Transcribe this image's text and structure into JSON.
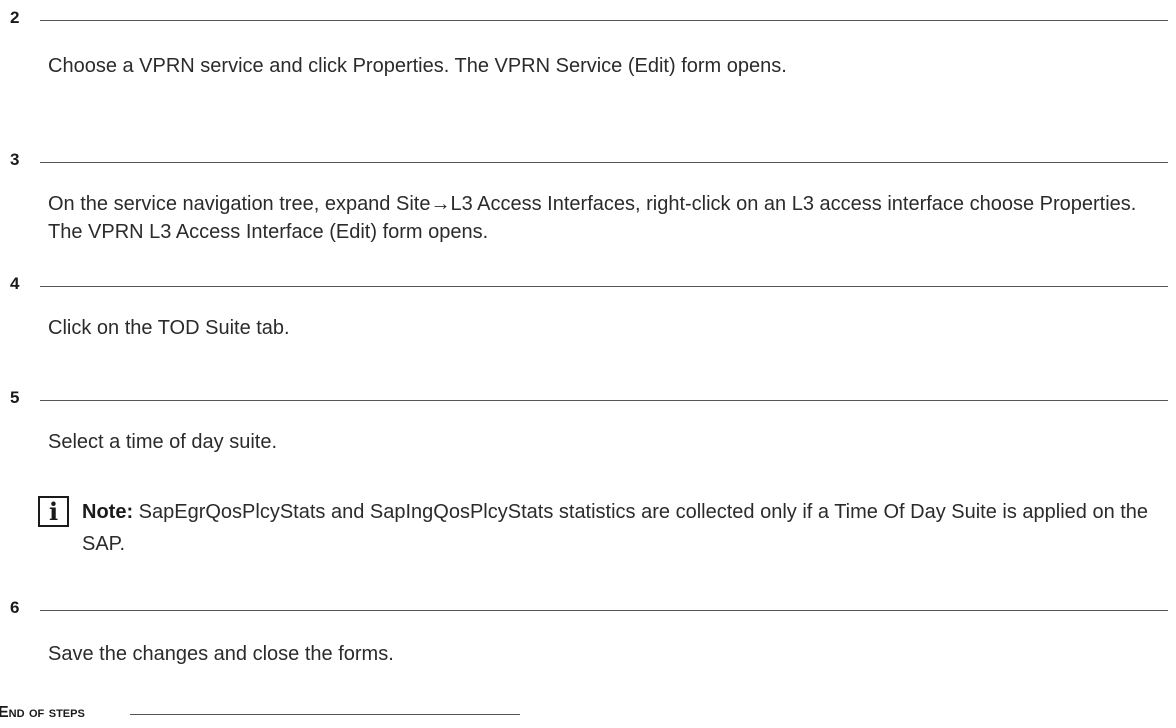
{
  "steps": [
    {
      "number": "2",
      "text": "Choose a VPRN service and click Properties. The VPRN Service (Edit) form opens."
    },
    {
      "number": "3",
      "text": "On the service navigation tree, expand Site→L3 Access Interfaces, right-click on an L3 access interface choose Properties. The VPRN L3 Access Interface (Edit) form opens."
    },
    {
      "number": "4",
      "text": "Click on the TOD Suite tab."
    },
    {
      "number": "5",
      "text": "Select a time of day suite."
    },
    {
      "number": "6",
      "text": "Save the changes and close the forms."
    }
  ],
  "note": {
    "icon": "info-icon",
    "icon_glyph": "i",
    "label": "Note:",
    "text": " SapEgrQosPlcyStats and SapIngQosPlcyStats statistics are collected only if a Time Of Day Suite is applied on the SAP."
  },
  "end_of_steps": "End of steps"
}
